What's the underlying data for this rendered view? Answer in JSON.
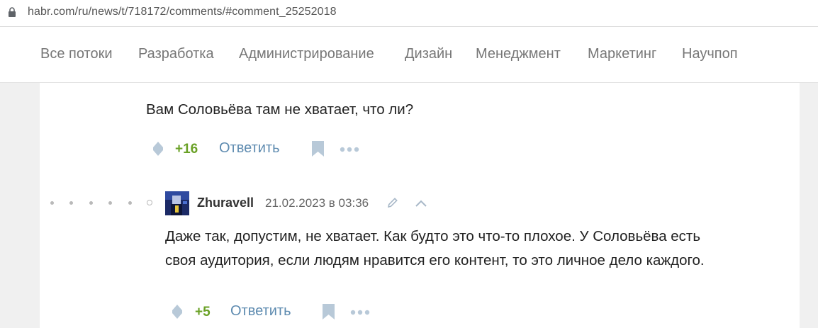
{
  "browser": {
    "url": "habr.com/ru/news/t/718172/comments/#comment_25252018"
  },
  "nav": {
    "items": [
      "Все потоки",
      "Разработка",
      "Администрирование",
      "Дизайн",
      "Менеджмент",
      "Маркетинг",
      "Научпоп"
    ]
  },
  "comments": [
    {
      "text": "Вам Соловьёва там не хватает, что ли?",
      "score": "+16",
      "reply_label": "Ответить"
    },
    {
      "author": "Zhuravell",
      "date": "21.02.2023 в 03:36",
      "text_line1": "Даже так, допустим, не хватает. Как будто это что-то плохое. У Соловьёва есть",
      "text_line2": "своя аудитория, если людям нравится его контент, то это личное дело каждого.",
      "score": "+5",
      "reply_label": "Ответить"
    }
  ],
  "colors": {
    "score_positive": "#6aa126",
    "reply_link": "#5e8bb0",
    "nav_text": "#777777"
  }
}
